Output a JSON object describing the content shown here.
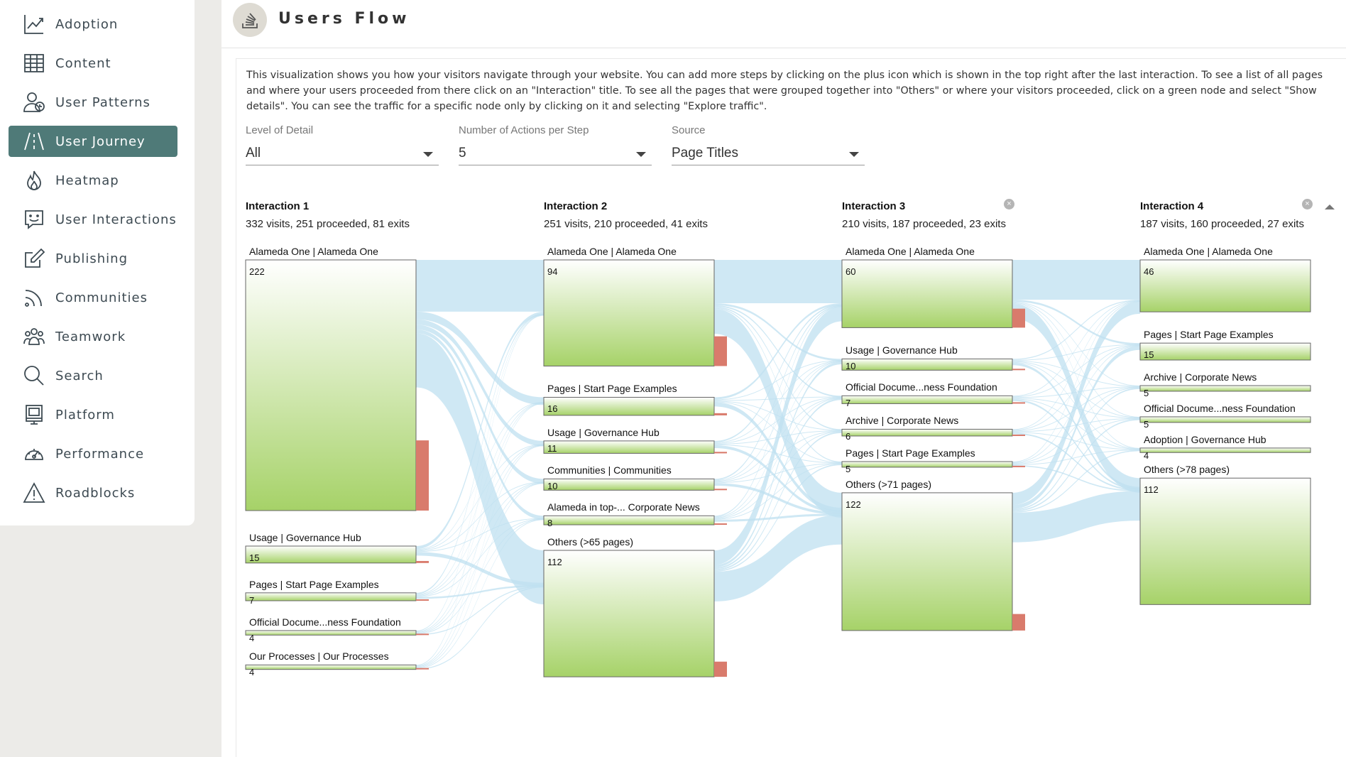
{
  "sidebar": {
    "items": [
      {
        "label": "Adoption",
        "icon": "trend-chart-icon",
        "active": false
      },
      {
        "label": "Content",
        "icon": "grid-table-icon",
        "active": false
      },
      {
        "label": "User Patterns",
        "icon": "user-clock-icon",
        "active": false
      },
      {
        "label": "User Journey",
        "icon": "road-icon",
        "active": true
      },
      {
        "label": "Heatmap",
        "icon": "flame-icon",
        "active": false
      },
      {
        "label": "User Interactions",
        "icon": "smiley-chat-icon",
        "active": false
      },
      {
        "label": "Publishing",
        "icon": "edit-pen-icon",
        "active": false
      },
      {
        "label": "Communities",
        "icon": "rss-icon",
        "active": false
      },
      {
        "label": "Teamwork",
        "icon": "team-people-icon",
        "active": false
      },
      {
        "label": "Search",
        "icon": "search-icon",
        "active": false
      },
      {
        "label": "Platform",
        "icon": "platform-monitor-icon",
        "active": false
      },
      {
        "label": "Performance",
        "icon": "gauge-icon",
        "active": false
      },
      {
        "label": "Roadblocks",
        "icon": "warning-triangle-icon",
        "active": false
      }
    ]
  },
  "header": {
    "title": "Users Flow",
    "logo_icon": "stack-logo-icon"
  },
  "description": "This visualization shows you how your visitors navigate through your website. You can add more steps by clicking on the plus icon which is shown in the top right after the last interaction. To see a list of all pages and where your users proceeded from there click on an \"Interaction\" title. To see all the pages that were grouped together into \"Others\" or where your visitors proceeded, click on a green node and select \"Show details\". You can see the traffic for a specific node only by clicking on it and selecting \"Explore traffic\".",
  "filters": {
    "level": {
      "label": "Level of Detail",
      "value": "All"
    },
    "actions": {
      "label": "Number of Actions per Step",
      "value": "5"
    },
    "source": {
      "label": "Source",
      "value": "Page Titles"
    }
  },
  "colors": {
    "node": "#a6d268",
    "exit": "#d97b6c",
    "flow": "#bfe0f0",
    "active_nav": "#4f7a78"
  },
  "chart_data": {
    "type": "sankey",
    "interactions": [
      {
        "title": "Interaction 1",
        "summary": "332 visits, 251 proceeded, 81 exits",
        "removable": false,
        "nodes": [
          {
            "label": "Alameda One | Alameda One",
            "value": 222
          },
          {
            "label": "Usage | Governance Hub",
            "value": 15
          },
          {
            "label": "Pages | Start Page Examples",
            "value": 7
          },
          {
            "label": "Official Docume...ness Foundation",
            "value": 4
          },
          {
            "label": "Our Processes | Our Processes",
            "value": 4
          }
        ]
      },
      {
        "title": "Interaction 2",
        "summary": "251 visits, 210 proceeded, 41 exits",
        "removable": false,
        "nodes": [
          {
            "label": "Alameda One | Alameda One",
            "value": 94
          },
          {
            "label": "Pages | Start Page Examples",
            "value": 16
          },
          {
            "label": "Usage | Governance Hub",
            "value": 11
          },
          {
            "label": "Communities | Communities",
            "value": 10
          },
          {
            "label": "Alameda in top-... Corporate News",
            "value": 8
          },
          {
            "label": "Others (>65 pages)",
            "value": 112
          }
        ]
      },
      {
        "title": "Interaction 3",
        "summary": "210 visits, 187 proceeded, 23 exits",
        "removable": true,
        "nodes": [
          {
            "label": "Alameda One | Alameda One",
            "value": 60
          },
          {
            "label": "Usage | Governance Hub",
            "value": 10
          },
          {
            "label": "Official Docume...ness Foundation",
            "value": 7
          },
          {
            "label": "Archive | Corporate News",
            "value": 6
          },
          {
            "label": "Pages | Start Page Examples",
            "value": 5
          },
          {
            "label": "Others (>71 pages)",
            "value": 122
          }
        ]
      },
      {
        "title": "Interaction 4",
        "summary": "187 visits, 160 proceeded, 27 exits",
        "removable": true,
        "nodes": [
          {
            "label": "Alameda One | Alameda One",
            "value": 46
          },
          {
            "label": "Pages | Start Page Examples",
            "value": 15
          },
          {
            "label": "Archive | Corporate News",
            "value": 5
          },
          {
            "label": "Official Docume...ness Foundation",
            "value": 5
          },
          {
            "label": "Adoption | Governance Hub",
            "value": 4
          },
          {
            "label": "Others (>78 pages)",
            "value": 112
          }
        ]
      }
    ]
  }
}
